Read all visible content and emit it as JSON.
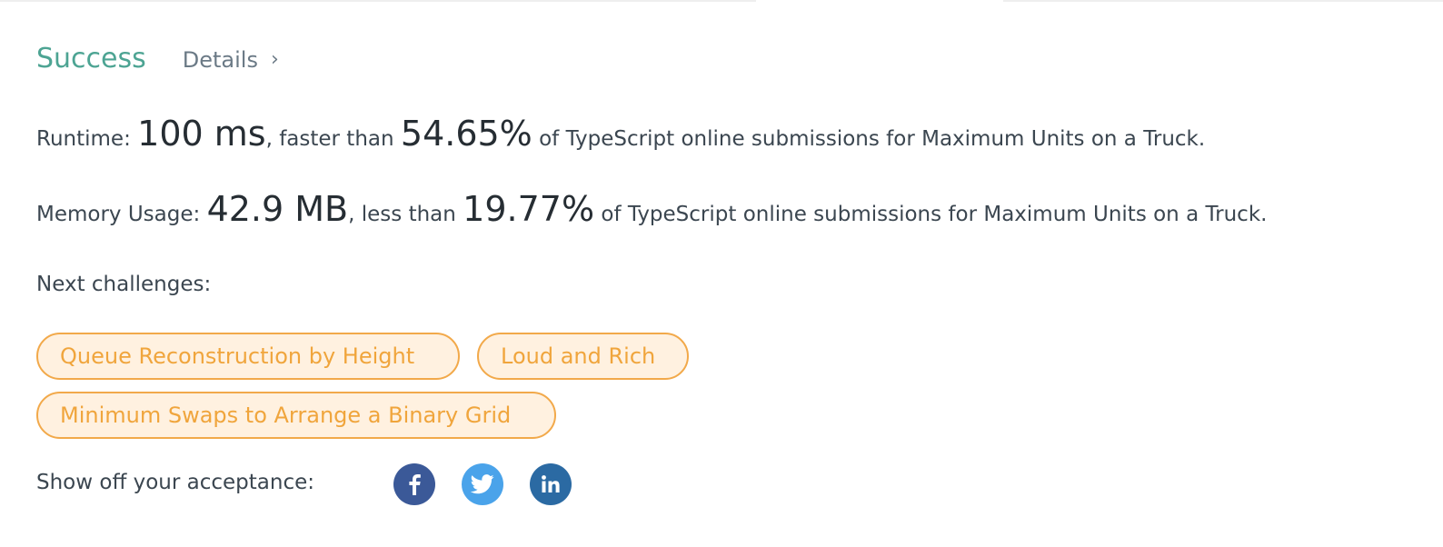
{
  "result": {
    "status": "Success",
    "details_label": "Details",
    "details_chevron": "›"
  },
  "runtime": {
    "label": "Runtime:",
    "value": "100 ms",
    "connector": ", faster than",
    "percent": "54.65%",
    "suffix": "of TypeScript online submissions for Maximum Units on a Truck."
  },
  "memory": {
    "label": "Memory Usage:",
    "value": "42.9 MB",
    "connector": ", less than",
    "percent": "19.77%",
    "suffix": "of TypeScript online submissions for Maximum Units on a Truck."
  },
  "next_challenges": {
    "label": "Next challenges:",
    "items": [
      "Queue Reconstruction by Height",
      "Loud and Rich",
      "Minimum Swaps to Arrange a Binary Grid"
    ]
  },
  "share": {
    "label": "Show off your acceptance:",
    "icons": [
      "facebook-icon",
      "twitter-icon",
      "linkedin-icon"
    ]
  },
  "colors": {
    "success": "#4da493",
    "pill_border": "#f2a94a",
    "pill_background": "#fff1e0",
    "pill_text": "#f0a53c",
    "facebook": "#3b5998",
    "twitter": "#4aa3ea",
    "linkedin": "#2b6aa3"
  }
}
